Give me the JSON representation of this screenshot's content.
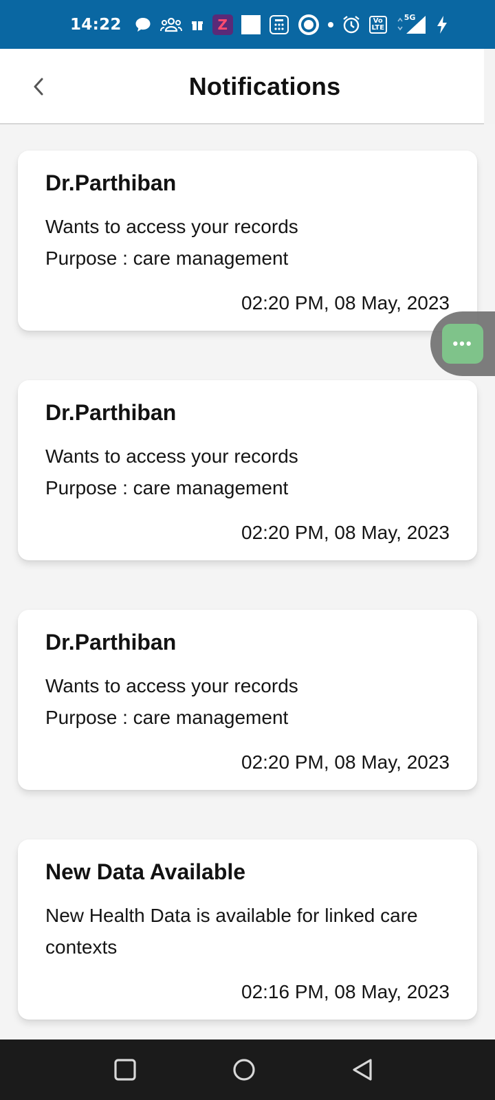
{
  "status_bar": {
    "time": "14:22",
    "icons": [
      "chat-bubble-icon",
      "group-icon",
      "gift-icon",
      "zapp-app-icon",
      "white-square-icon",
      "calculator-icon",
      "circle-app-icon",
      "dot-icon",
      "alarm-icon",
      "volte-icon",
      "signal-5g-icon",
      "charging-icon"
    ],
    "zapp_letter": "Z",
    "volte_label": "Vo LTE",
    "network_label": "5G"
  },
  "header": {
    "title": "Notifications"
  },
  "notifications": [
    {
      "title": "Dr.Parthiban",
      "message": "Wants to access your records",
      "purpose": "Purpose : care management",
      "time": "02:20 PM, 08 May, 2023"
    },
    {
      "title": "Dr.Parthiban",
      "message": "Wants to access your records",
      "purpose": "Purpose : care management",
      "time": "02:20 PM, 08 May, 2023"
    },
    {
      "title": "Dr.Parthiban",
      "message": "Wants to access your records",
      "purpose": "Purpose : care management",
      "time": "02:20 PM, 08 May, 2023"
    },
    {
      "title": "New Data Available",
      "message": "New Health Data is available for linked care contexts",
      "purpose": "",
      "time": "02:16 PM, 08 May, 2023"
    }
  ],
  "floating_button": {
    "label": "•••",
    "color": "#7fc38a"
  },
  "colors": {
    "status_bar": "#0a67a2",
    "background": "#f4f4f4",
    "card": "#ffffff",
    "nav_bar": "#1b1b1b"
  }
}
